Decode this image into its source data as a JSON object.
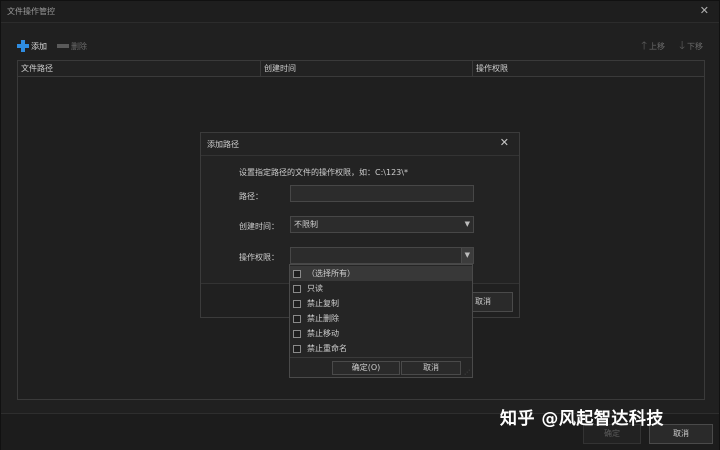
{
  "window": {
    "title": "文件操作管控",
    "close_glyph": "✕"
  },
  "toolbar": {
    "add_label": "添加",
    "delete_label": "删除",
    "up_label": "上移",
    "down_label": "下移"
  },
  "grid": {
    "columns": [
      "文件路径",
      "创建时间",
      "操作权限"
    ]
  },
  "main_buttons": {
    "ok_label": "确定",
    "cancel_label": "取消"
  },
  "dialog": {
    "title": "添加路径",
    "close_glyph": "✕",
    "hint": "设置指定路径的文件的操作权限，如：C:\\123\\*",
    "path_label": "路径：",
    "path_value": "",
    "time_label": "创建时间：",
    "time_value": "不限制",
    "perm_label": "操作权限：",
    "perm_value": "",
    "cancel_label": "取消"
  },
  "dropdown": {
    "options": [
      "（选择所有）",
      "只读",
      "禁止复制",
      "禁止删除",
      "禁止移动",
      "禁止重命名"
    ],
    "ok_label": "确定(O)",
    "cancel_label": "取消"
  },
  "watermark": "知乎 @风起智达科技",
  "colors": {
    "accent": "#2f8ce0",
    "background": "#202020",
    "text": "#cfcfcf"
  }
}
